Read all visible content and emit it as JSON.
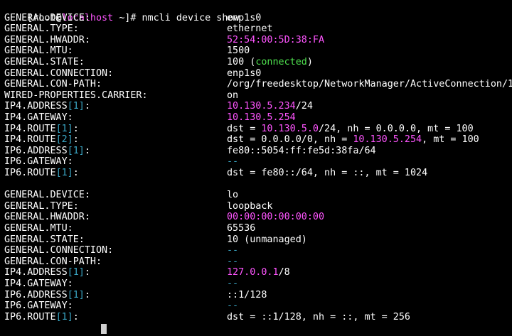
{
  "colors": {
    "background": "#000000",
    "text": "#ffffff",
    "host": "#ff55ff",
    "index": "#3aa6c4",
    "magenta": "#ff55ff",
    "green": "#4ee04e",
    "cyan": "#3aa6c4",
    "cursor": "#cfcfcf"
  },
  "prompt": {
    "open": "[root@",
    "host": "localhost",
    "rest": " ~]# ",
    "command": "nmcli device show"
  },
  "blocks": [
    {
      "name": "enp1s0",
      "rows": [
        {
          "key": [
            {
              "t": "GENERAL.DEVICE:"
            }
          ],
          "val": [
            {
              "t": "enp1s0"
            }
          ]
        },
        {
          "key": [
            {
              "t": "GENERAL.TYPE:"
            }
          ],
          "val": [
            {
              "t": "ethernet"
            }
          ]
        },
        {
          "key": [
            {
              "t": "GENERAL.HWADDR:"
            }
          ],
          "val": [
            {
              "t": "52:54:00:5D:38:FA",
              "c": "mag"
            }
          ]
        },
        {
          "key": [
            {
              "t": "GENERAL.MTU:"
            }
          ],
          "val": [
            {
              "t": "1500"
            }
          ]
        },
        {
          "key": [
            {
              "t": "GENERAL.STATE:"
            }
          ],
          "val": [
            {
              "t": "100 ("
            },
            {
              "t": "connected",
              "c": "grn"
            },
            {
              "t": ")"
            }
          ]
        },
        {
          "key": [
            {
              "t": "GENERAL.CONNECTION:"
            }
          ],
          "val": [
            {
              "t": "enp1s0"
            }
          ]
        },
        {
          "key": [
            {
              "t": "GENERAL.CON-PATH:"
            }
          ],
          "val": [
            {
              "t": "/org/freedesktop/NetworkManager/ActiveConnection/1"
            }
          ]
        },
        {
          "key": [
            {
              "t": "WIRED-PROPERTIES.CARRIER:"
            }
          ],
          "val": [
            {
              "t": "on"
            }
          ]
        },
        {
          "key": [
            {
              "t": "IP4.ADDRESS"
            },
            {
              "t": "[1]",
              "c": "idx"
            },
            {
              "t": ":"
            }
          ],
          "val": [
            {
              "t": "10.130.5.234",
              "c": "mag"
            },
            {
              "t": "/24"
            }
          ]
        },
        {
          "key": [
            {
              "t": "IP4.GATEWAY:"
            }
          ],
          "val": [
            {
              "t": "10.130.5.254",
              "c": "mag"
            }
          ]
        },
        {
          "key": [
            {
              "t": "IP4.ROUTE"
            },
            {
              "t": "[1]",
              "c": "idx"
            },
            {
              "t": ":"
            }
          ],
          "val": [
            {
              "t": "dst = "
            },
            {
              "t": "10.130.5.0",
              "c": "mag"
            },
            {
              "t": "/24, nh = 0.0.0.0, mt = 100"
            }
          ]
        },
        {
          "key": [
            {
              "t": "IP4.ROUTE"
            },
            {
              "t": "[2]",
              "c": "idx"
            },
            {
              "t": ":"
            }
          ],
          "val": [
            {
              "t": "dst = 0.0.0.0/0, nh = "
            },
            {
              "t": "10.130.5.254",
              "c": "mag"
            },
            {
              "t": ", mt = 100"
            }
          ]
        },
        {
          "key": [
            {
              "t": "IP6.ADDRESS"
            },
            {
              "t": "[1]",
              "c": "idx"
            },
            {
              "t": ":"
            }
          ],
          "val": [
            {
              "t": "fe80::5054:ff:fe5d:38fa/64"
            }
          ]
        },
        {
          "key": [
            {
              "t": "IP6.GATEWAY:"
            }
          ],
          "val": [
            {
              "t": "--",
              "c": "cyan"
            }
          ]
        },
        {
          "key": [
            {
              "t": "IP6.ROUTE"
            },
            {
              "t": "[1]",
              "c": "idx"
            },
            {
              "t": ":"
            }
          ],
          "val": [
            {
              "t": "dst = fe80::/64, nh = ::, mt = 1024"
            }
          ]
        }
      ]
    },
    {
      "name": "lo",
      "rows": [
        {
          "key": [
            {
              "t": "GENERAL.DEVICE:"
            }
          ],
          "val": [
            {
              "t": "lo"
            }
          ]
        },
        {
          "key": [
            {
              "t": "GENERAL.TYPE:"
            }
          ],
          "val": [
            {
              "t": "loopback"
            }
          ]
        },
        {
          "key": [
            {
              "t": "GENERAL.HWADDR:"
            }
          ],
          "val": [
            {
              "t": "00:00:00:00:00:00",
              "c": "mag"
            }
          ]
        },
        {
          "key": [
            {
              "t": "GENERAL.MTU:"
            }
          ],
          "val": [
            {
              "t": "65536"
            }
          ]
        },
        {
          "key": [
            {
              "t": "GENERAL.STATE:"
            }
          ],
          "val": [
            {
              "t": "10 (unmanaged)"
            }
          ]
        },
        {
          "key": [
            {
              "t": "GENERAL.CONNECTION:"
            }
          ],
          "val": [
            {
              "t": "--",
              "c": "cyan"
            }
          ]
        },
        {
          "key": [
            {
              "t": "GENERAL.CON-PATH:"
            }
          ],
          "val": [
            {
              "t": "--",
              "c": "cyan"
            }
          ]
        },
        {
          "key": [
            {
              "t": "IP4.ADDRESS"
            },
            {
              "t": "[1]",
              "c": "idx"
            },
            {
              "t": ":"
            }
          ],
          "val": [
            {
              "t": "127.0.0.1",
              "c": "mag"
            },
            {
              "t": "/8"
            }
          ]
        },
        {
          "key": [
            {
              "t": "IP4.GATEWAY:"
            }
          ],
          "val": [
            {
              "t": "--",
              "c": "cyan"
            }
          ]
        },
        {
          "key": [
            {
              "t": "IP6.ADDRESS"
            },
            {
              "t": "[1]",
              "c": "idx"
            },
            {
              "t": ":"
            }
          ],
          "val": [
            {
              "t": "::1/128"
            }
          ]
        },
        {
          "key": [
            {
              "t": "IP6.GATEWAY:"
            }
          ],
          "val": [
            {
              "t": "--",
              "c": "cyan"
            }
          ]
        },
        {
          "key": [
            {
              "t": "IP6.ROUTE"
            },
            {
              "t": "[1]",
              "c": "idx"
            },
            {
              "t": ":"
            }
          ],
          "val": [
            {
              "t": "dst = ::1/128, nh = ::, mt = 256"
            }
          ]
        }
      ]
    }
  ]
}
